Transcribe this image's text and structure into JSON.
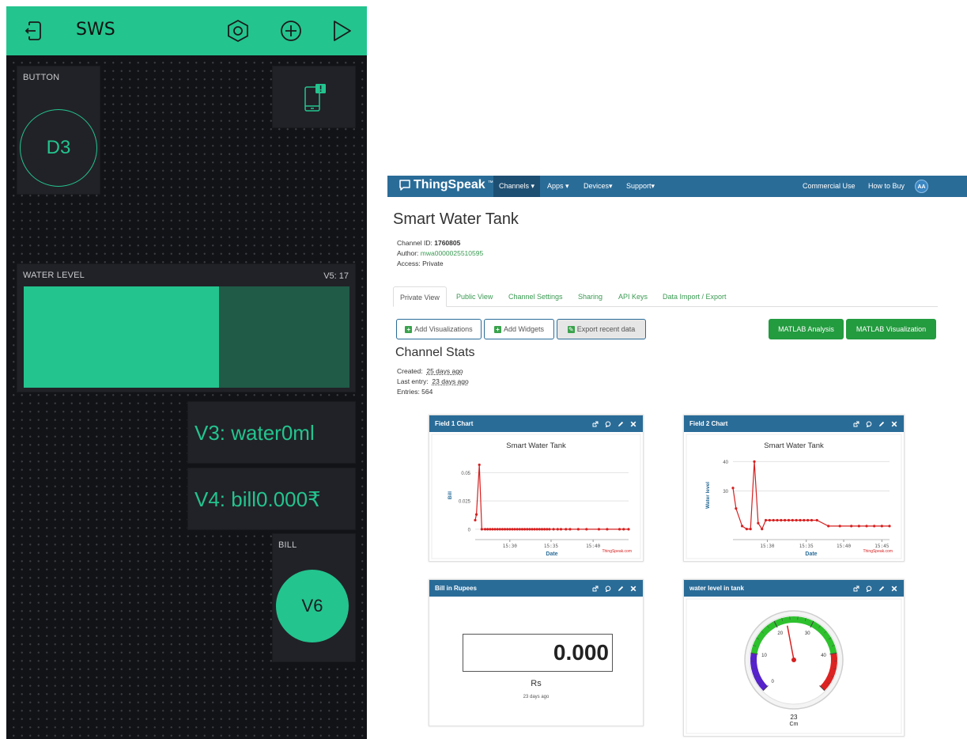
{
  "blynk": {
    "title": "SWS",
    "accent": "#23c48e",
    "icons": [
      "exit-icon",
      "settings-hex-icon",
      "add-circle-icon",
      "play-icon"
    ],
    "button_widget": {
      "label": "BUTTON",
      "pin": "D3"
    },
    "notification_widget": {
      "icon": "phone-notification-icon"
    },
    "level_widget": {
      "label": "WATER LEVEL",
      "value_text": "V5: 17",
      "fill_fraction": 0.6
    },
    "display_water": {
      "text": "V3: water0ml"
    },
    "display_bill": {
      "text": "V4: bill0.000₹"
    },
    "bill_widget": {
      "label": "BILL",
      "pin": "V6"
    }
  },
  "thingspeak": {
    "logo": "ThingSpeak",
    "logo_tm": "™",
    "nav": {
      "channels": "Channels ▾",
      "apps": "Apps ▾",
      "devices": "Devices▾",
      "support": "Support▾",
      "commercial": "Commercial Use",
      "how_to_buy": "How to Buy",
      "avatar": "AA"
    },
    "channel": {
      "title": "Smart Water Tank",
      "id_label": "Channel ID: ",
      "id_value": "1760805",
      "author_label": "Author: ",
      "author_value": "mwa0000025510595",
      "access": "Access: Private"
    },
    "tabs": [
      "Private View",
      "Public View",
      "Channel Settings",
      "Sharing",
      "API Keys",
      "Data Import / Export"
    ],
    "buttons": {
      "add_viz": "Add Visualizations",
      "add_widgets": "Add Widgets",
      "export": "Export recent data",
      "matlab_analysis": "MATLAB Analysis",
      "matlab_viz": "MATLAB Visualization"
    },
    "stats": {
      "title": "Channel Stats",
      "created_label": "Created:",
      "created_value": "25 days ago",
      "last_label": "Last entry:",
      "last_value": "23 days ago",
      "entries": "Entries: 564"
    },
    "panels": {
      "field1": "Field 1 Chart",
      "field2": "Field 2 Chart",
      "bill": "Bill in Rupees",
      "level": "water level in tank"
    },
    "lamp": {
      "value": "0.000",
      "unit": "Rs",
      "time": "23 days ago"
    },
    "credit": "ThingSpeak.com"
  },
  "chart_data": [
    {
      "type": "line",
      "title": "Smart Water Tank",
      "xlabel": "Date",
      "ylabel": "Bill",
      "x_ticks": [
        "15:30",
        "15:35",
        "15:40"
      ],
      "y_ticks": [
        "0",
        "0.025",
        "0.05"
      ],
      "ylim": [
        -0.005,
        0.065
      ],
      "color": "#d62020",
      "series": [
        {
          "x": [
            0,
            1.5,
            5,
            8,
            12,
            15,
            18,
            21,
            24,
            27,
            30,
            33,
            36,
            39,
            42,
            45,
            48,
            51,
            54,
            57,
            60,
            63,
            66,
            69,
            72,
            75,
            78,
            81,
            84,
            87,
            90,
            95,
            100,
            104,
            110,
            115,
            125,
            135,
            150,
            160,
            175,
            180,
            186
          ],
          "y": [
            0.008,
            0.013,
            0.057,
            0,
            0,
            0,
            0,
            0,
            0,
            0,
            0,
            0,
            0,
            0,
            0,
            0,
            0,
            0,
            0,
            0,
            0,
            0,
            0,
            0,
            0,
            0,
            0,
            0,
            0,
            0,
            0,
            0,
            0,
            0,
            0,
            0,
            0,
            0,
            0,
            0,
            0,
            0,
            0
          ]
        }
      ]
    },
    {
      "type": "line",
      "title": "Smart Water Tank",
      "xlabel": "Date",
      "ylabel": "Water level",
      "x_ticks": [
        "15:30",
        "15:35",
        "15:40",
        "15:45"
      ],
      "y_ticks": [
        "30",
        "40"
      ],
      "ylim": [
        15,
        42
      ],
      "color": "#d62020",
      "series": [
        {
          "x": [
            0,
            4,
            12,
            18,
            23,
            28,
            33,
            38,
            43,
            48,
            53,
            58,
            63,
            68,
            73,
            78,
            83,
            88,
            93,
            98,
            103,
            110,
            125,
            140,
            155,
            165,
            175,
            185,
            195,
            205
          ],
          "y": [
            31,
            24,
            18,
            17,
            17,
            40,
            19,
            17,
            20,
            20,
            20,
            20,
            20,
            20,
            20,
            20,
            20,
            20,
            20,
            20,
            20,
            20,
            18,
            18,
            18,
            18,
            18,
            18,
            18,
            18
          ]
        }
      ]
    },
    {
      "type": "gauge",
      "min": 0,
      "max": 50,
      "value": 23,
      "unit": "Cm",
      "tick_labels": [
        "0",
        "10",
        "20",
        "30",
        "40"
      ],
      "bands": [
        {
          "from": 0,
          "to": 10,
          "color": "#5522cc"
        },
        {
          "from": 10,
          "to": 40,
          "color": "#2ec12e"
        },
        {
          "from": 40,
          "to": 50,
          "color": "#dd2222"
        }
      ]
    }
  ]
}
